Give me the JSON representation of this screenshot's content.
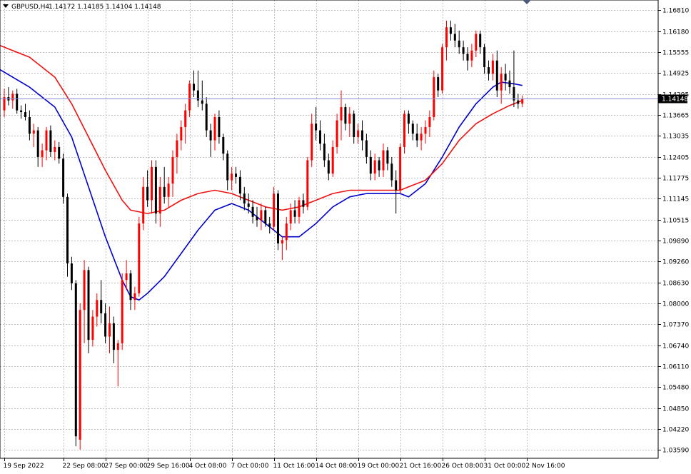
{
  "header": {
    "symbol": "GBPUSD,H4",
    "ohlc": "1.14172 1.14185 1.14104 1.14148"
  },
  "colors": {
    "bull": "#ff0000",
    "bear": "#000000",
    "ma_fast": "#0000cc",
    "ma_slow": "#ee1111",
    "grid": "#c0c0c0",
    "current_bg": "#000000",
    "current_line": "#8c8cd8"
  },
  "chart_data": {
    "type": "candlestick",
    "symbol": "GBPUSD",
    "timeframe": "H4",
    "grid": true,
    "ylim": [
      1.0334,
      1.1712
    ],
    "xlim": [
      0,
      122
    ],
    "y_ticks": [
      "1.16810",
      "1.16180",
      "1.15555",
      "1.14925",
      "1.14295",
      "1.13665",
      "1.13035",
      "1.12405",
      "1.11775",
      "1.11145",
      "1.10515",
      "1.09890",
      "1.09260",
      "1.08630",
      "1.08000",
      "1.07370",
      "1.06740",
      "1.06110",
      "1.05480",
      "1.04850",
      "1.04220",
      "1.03590"
    ],
    "x_ticks": [
      {
        "label": "19 Sep 2022",
        "bar": 0
      },
      {
        "label": "22 Sep 08:00",
        "bar": 14
      },
      {
        "label": "27 Sep 00:00",
        "bar": 24
      },
      {
        "label": "29 Sep 16:00",
        "bar": 34
      },
      {
        "label": "4 Oct 08:00",
        "bar": 44
      },
      {
        "label": "7 Oct 00:00",
        "bar": 54
      },
      {
        "label": "11 Oct 16:00",
        "bar": 64
      },
      {
        "label": "14 Oct 08:00",
        "bar": 74
      },
      {
        "label": "19 Oct 00:00",
        "bar": 84
      },
      {
        "label": "21 Oct 16:00",
        "bar": 94
      },
      {
        "label": "26 Oct 08:00",
        "bar": 104
      },
      {
        "label": "31 Oct 00:00",
        "bar": 114
      },
      {
        "label": "2 Nov 16:00",
        "bar": 124
      }
    ],
    "current_price": "1.14148",
    "candles": [
      {
        "o": 1.138,
        "h": 1.1445,
        "l": 1.136,
        "c": 1.142
      },
      {
        "o": 1.142,
        "h": 1.145,
        "l": 1.1395,
        "c": 1.141
      },
      {
        "o": 1.141,
        "h": 1.144,
        "l": 1.1385,
        "c": 1.143
      },
      {
        "o": 1.143,
        "h": 1.1445,
        "l": 1.137,
        "c": 1.138
      },
      {
        "o": 1.138,
        "h": 1.1395,
        "l": 1.1355,
        "c": 1.1375
      },
      {
        "o": 1.1375,
        "h": 1.14,
        "l": 1.135,
        "c": 1.136
      },
      {
        "o": 1.136,
        "h": 1.138,
        "l": 1.129,
        "c": 1.131
      },
      {
        "o": 1.131,
        "h": 1.134,
        "l": 1.127,
        "c": 1.132
      },
      {
        "o": 1.132,
        "h": 1.133,
        "l": 1.121,
        "c": 1.124
      },
      {
        "o": 1.124,
        "h": 1.128,
        "l": 1.121,
        "c": 1.126
      },
      {
        "o": 1.126,
        "h": 1.133,
        "l": 1.123,
        "c": 1.132
      },
      {
        "o": 1.132,
        "h": 1.1335,
        "l": 1.124,
        "c": 1.1255
      },
      {
        "o": 1.1255,
        "h": 1.129,
        "l": 1.123,
        "c": 1.127
      },
      {
        "o": 1.127,
        "h": 1.1285,
        "l": 1.122,
        "c": 1.1235
      },
      {
        "o": 1.1235,
        "h": 1.125,
        "l": 1.11,
        "c": 1.112
      },
      {
        "o": 1.112,
        "h": 1.113,
        "l": 1.088,
        "c": 1.092
      },
      {
        "o": 1.092,
        "h": 1.094,
        "l": 1.084,
        "c": 1.086
      },
      {
        "o": 1.086,
        "h": 1.087,
        "l": 1.037,
        "c": 1.04
      },
      {
        "o": 1.039,
        "h": 1.08,
        "l": 1.036,
        "c": 1.078
      },
      {
        "o": 1.078,
        "h": 1.093,
        "l": 1.068,
        "c": 1.09
      },
      {
        "o": 1.09,
        "h": 1.091,
        "l": 1.065,
        "c": 1.069
      },
      {
        "o": 1.069,
        "h": 1.078,
        "l": 1.067,
        "c": 1.076
      },
      {
        "o": 1.076,
        "h": 1.083,
        "l": 1.073,
        "c": 1.081
      },
      {
        "o": 1.081,
        "h": 1.087,
        "l": 1.074,
        "c": 1.077
      },
      {
        "o": 1.077,
        "h": 1.08,
        "l": 1.068,
        "c": 1.07
      },
      {
        "o": 1.07,
        "h": 1.079,
        "l": 1.065,
        "c": 1.074
      },
      {
        "o": 1.074,
        "h": 1.076,
        "l": 1.062,
        "c": 1.066
      },
      {
        "o": 1.066,
        "h": 1.069,
        "l": 1.055,
        "c": 1.068
      },
      {
        "o": 1.068,
        "h": 1.089,
        "l": 1.066,
        "c": 1.087
      },
      {
        "o": 1.087,
        "h": 1.093,
        "l": 1.084,
        "c": 1.089
      },
      {
        "o": 1.089,
        "h": 1.09,
        "l": 1.078,
        "c": 1.081
      },
      {
        "o": 1.081,
        "h": 1.085,
        "l": 1.078,
        "c": 1.083
      },
      {
        "o": 1.083,
        "h": 1.106,
        "l": 1.082,
        "c": 1.104
      },
      {
        "o": 1.104,
        "h": 1.118,
        "l": 1.102,
        "c": 1.115
      },
      {
        "o": 1.115,
        "h": 1.12,
        "l": 1.109,
        "c": 1.111
      },
      {
        "o": 1.111,
        "h": 1.123,
        "l": 1.107,
        "c": 1.121
      },
      {
        "o": 1.121,
        "h": 1.123,
        "l": 1.104,
        "c": 1.107
      },
      {
        "o": 1.107,
        "h": 1.118,
        "l": 1.103,
        "c": 1.115
      },
      {
        "o": 1.115,
        "h": 1.121,
        "l": 1.11,
        "c": 1.112
      },
      {
        "o": 1.112,
        "h": 1.118,
        "l": 1.109,
        "c": 1.116
      },
      {
        "o": 1.116,
        "h": 1.126,
        "l": 1.112,
        "c": 1.124
      },
      {
        "o": 1.124,
        "h": 1.131,
        "l": 1.119,
        "c": 1.129
      },
      {
        "o": 1.129,
        "h": 1.135,
        "l": 1.126,
        "c": 1.133
      },
      {
        "o": 1.133,
        "h": 1.14,
        "l": 1.128,
        "c": 1.138
      },
      {
        "o": 1.138,
        "h": 1.147,
        "l": 1.136,
        "c": 1.146
      },
      {
        "o": 1.146,
        "h": 1.15,
        "l": 1.142,
        "c": 1.144
      },
      {
        "o": 1.144,
        "h": 1.15,
        "l": 1.139,
        "c": 1.141
      },
      {
        "o": 1.141,
        "h": 1.147,
        "l": 1.138,
        "c": 1.14
      },
      {
        "o": 1.14,
        "h": 1.142,
        "l": 1.13,
        "c": 1.132
      },
      {
        "o": 1.132,
        "h": 1.134,
        "l": 1.124,
        "c": 1.129
      },
      {
        "o": 1.129,
        "h": 1.137,
        "l": 1.126,
        "c": 1.136
      },
      {
        "o": 1.136,
        "h": 1.138,
        "l": 1.128,
        "c": 1.13
      },
      {
        "o": 1.13,
        "h": 1.131,
        "l": 1.123,
        "c": 1.125
      },
      {
        "o": 1.125,
        "h": 1.126,
        "l": 1.114,
        "c": 1.117
      },
      {
        "o": 1.117,
        "h": 1.121,
        "l": 1.114,
        "c": 1.119
      },
      {
        "o": 1.119,
        "h": 1.121,
        "l": 1.116,
        "c": 1.118
      },
      {
        "o": 1.118,
        "h": 1.12,
        "l": 1.111,
        "c": 1.113
      },
      {
        "o": 1.113,
        "h": 1.115,
        "l": 1.108,
        "c": 1.11
      },
      {
        "o": 1.11,
        "h": 1.113,
        "l": 1.107,
        "c": 1.109
      },
      {
        "o": 1.109,
        "h": 1.111,
        "l": 1.104,
        "c": 1.106
      },
      {
        "o": 1.106,
        "h": 1.109,
        "l": 1.103,
        "c": 1.105
      },
      {
        "o": 1.105,
        "h": 1.11,
        "l": 1.102,
        "c": 1.108
      },
      {
        "o": 1.108,
        "h": 1.109,
        "l": 1.103,
        "c": 1.104
      },
      {
        "o": 1.104,
        "h": 1.106,
        "l": 1.101,
        "c": 1.103
      },
      {
        "o": 1.103,
        "h": 1.115,
        "l": 1.102,
        "c": 1.113
      },
      {
        "o": 1.113,
        "h": 1.114,
        "l": 1.096,
        "c": 1.098
      },
      {
        "o": 1.098,
        "h": 1.1,
        "l": 1.093,
        "c": 1.099
      },
      {
        "o": 1.099,
        "h": 1.106,
        "l": 1.096,
        "c": 1.104
      },
      {
        "o": 1.104,
        "h": 1.11,
        "l": 1.102,
        "c": 1.108
      },
      {
        "o": 1.108,
        "h": 1.111,
        "l": 1.104,
        "c": 1.106
      },
      {
        "o": 1.106,
        "h": 1.112,
        "l": 1.104,
        "c": 1.111
      },
      {
        "o": 1.111,
        "h": 1.113,
        "l": 1.107,
        "c": 1.109
      },
      {
        "o": 1.109,
        "h": 1.124,
        "l": 1.108,
        "c": 1.123
      },
      {
        "o": 1.123,
        "h": 1.137,
        "l": 1.121,
        "c": 1.134
      },
      {
        "o": 1.134,
        "h": 1.139,
        "l": 1.129,
        "c": 1.132
      },
      {
        "o": 1.132,
        "h": 1.135,
        "l": 1.126,
        "c": 1.128
      },
      {
        "o": 1.128,
        "h": 1.131,
        "l": 1.121,
        "c": 1.123
      },
      {
        "o": 1.123,
        "h": 1.125,
        "l": 1.117,
        "c": 1.119
      },
      {
        "o": 1.119,
        "h": 1.129,
        "l": 1.118,
        "c": 1.127
      },
      {
        "o": 1.127,
        "h": 1.137,
        "l": 1.125,
        "c": 1.135
      },
      {
        "o": 1.135,
        "h": 1.144,
        "l": 1.129,
        "c": 1.139
      },
      {
        "o": 1.139,
        "h": 1.14,
        "l": 1.132,
        "c": 1.134
      },
      {
        "o": 1.134,
        "h": 1.139,
        "l": 1.13,
        "c": 1.137
      },
      {
        "o": 1.137,
        "h": 1.138,
        "l": 1.128,
        "c": 1.13
      },
      {
        "o": 1.13,
        "h": 1.134,
        "l": 1.128,
        "c": 1.132
      },
      {
        "o": 1.132,
        "h": 1.135,
        "l": 1.126,
        "c": 1.129
      },
      {
        "o": 1.129,
        "h": 1.131,
        "l": 1.122,
        "c": 1.124
      },
      {
        "o": 1.124,
        "h": 1.126,
        "l": 1.117,
        "c": 1.119
      },
      {
        "o": 1.119,
        "h": 1.125,
        "l": 1.117,
        "c": 1.123
      },
      {
        "o": 1.123,
        "h": 1.124,
        "l": 1.118,
        "c": 1.12
      },
      {
        "o": 1.12,
        "h": 1.128,
        "l": 1.118,
        "c": 1.126
      },
      {
        "o": 1.126,
        "h": 1.127,
        "l": 1.12,
        "c": 1.122
      },
      {
        "o": 1.122,
        "h": 1.124,
        "l": 1.115,
        "c": 1.117
      },
      {
        "o": 1.117,
        "h": 1.12,
        "l": 1.107,
        "c": 1.114
      },
      {
        "o": 1.114,
        "h": 1.128,
        "l": 1.113,
        "c": 1.127
      },
      {
        "o": 1.127,
        "h": 1.138,
        "l": 1.125,
        "c": 1.137
      },
      {
        "o": 1.137,
        "h": 1.138,
        "l": 1.131,
        "c": 1.134
      },
      {
        "o": 1.134,
        "h": 1.135,
        "l": 1.129,
        "c": 1.131
      },
      {
        "o": 1.131,
        "h": 1.134,
        "l": 1.127,
        "c": 1.129
      },
      {
        "o": 1.129,
        "h": 1.133,
        "l": 1.126,
        "c": 1.131
      },
      {
        "o": 1.131,
        "h": 1.135,
        "l": 1.128,
        "c": 1.133
      },
      {
        "o": 1.133,
        "h": 1.138,
        "l": 1.13,
        "c": 1.136
      },
      {
        "o": 1.136,
        "h": 1.15,
        "l": 1.135,
        "c": 1.148
      },
      {
        "o": 1.148,
        "h": 1.149,
        "l": 1.142,
        "c": 1.144
      },
      {
        "o": 1.144,
        "h": 1.158,
        "l": 1.143,
        "c": 1.157
      },
      {
        "o": 1.157,
        "h": 1.165,
        "l": 1.153,
        "c": 1.163
      },
      {
        "o": 1.163,
        "h": 1.165,
        "l": 1.159,
        "c": 1.161
      },
      {
        "o": 1.161,
        "h": 1.164,
        "l": 1.157,
        "c": 1.159
      },
      {
        "o": 1.159,
        "h": 1.162,
        "l": 1.155,
        "c": 1.157
      },
      {
        "o": 1.157,
        "h": 1.159,
        "l": 1.153,
        "c": 1.155
      },
      {
        "o": 1.155,
        "h": 1.157,
        "l": 1.15,
        "c": 1.153
      },
      {
        "o": 1.153,
        "h": 1.158,
        "l": 1.151,
        "c": 1.156
      },
      {
        "o": 1.156,
        "h": 1.162,
        "l": 1.154,
        "c": 1.161
      },
      {
        "o": 1.161,
        "h": 1.162,
        "l": 1.155,
        "c": 1.157
      },
      {
        "o": 1.157,
        "h": 1.158,
        "l": 1.149,
        "c": 1.151
      },
      {
        "o": 1.151,
        "h": 1.153,
        "l": 1.147,
        "c": 1.149
      },
      {
        "o": 1.149,
        "h": 1.155,
        "l": 1.147,
        "c": 1.153
      },
      {
        "o": 1.153,
        "h": 1.156,
        "l": 1.142,
        "c": 1.144
      },
      {
        "o": 1.144,
        "h": 1.151,
        "l": 1.14,
        "c": 1.149
      },
      {
        "o": 1.149,
        "h": 1.152,
        "l": 1.144,
        "c": 1.147
      },
      {
        "o": 1.147,
        "h": 1.15,
        "l": 1.143,
        "c": 1.145
      },
      {
        "o": 1.145,
        "h": 1.156,
        "l": 1.139,
        "c": 1.141
      },
      {
        "o": 1.141,
        "h": 1.143,
        "l": 1.1385,
        "c": 1.14
      },
      {
        "o": 1.14,
        "h": 1.1425,
        "l": 1.139,
        "c": 1.1415
      }
    ],
    "series": [
      {
        "kind": "moving-average",
        "color": "#0000cc",
        "points": [
          [
            -2,
            1.151
          ],
          [
            6,
            1.145
          ],
          [
            12,
            1.139
          ],
          [
            16,
            1.13
          ],
          [
            20,
            1.115
          ],
          [
            24,
            1.1
          ],
          [
            28,
            1.087
          ],
          [
            30,
            1.082
          ],
          [
            32,
            1.081
          ],
          [
            34,
            1.083
          ],
          [
            38,
            1.088
          ],
          [
            42,
            1.095
          ],
          [
            46,
            1.102
          ],
          [
            50,
            1.108
          ],
          [
            54,
            1.11
          ],
          [
            58,
            1.108
          ],
          [
            62,
            1.104
          ],
          [
            66,
            1.1
          ],
          [
            70,
            1.1
          ],
          [
            74,
            1.104
          ],
          [
            78,
            1.109
          ],
          [
            82,
            1.112
          ],
          [
            86,
            1.113
          ],
          [
            90,
            1.113
          ],
          [
            94,
            1.113
          ],
          [
            96,
            1.112
          ],
          [
            100,
            1.116
          ],
          [
            104,
            1.124
          ],
          [
            108,
            1.133
          ],
          [
            112,
            1.14
          ],
          [
            116,
            1.145
          ],
          [
            118,
            1.1465
          ],
          [
            121,
            1.146
          ],
          [
            123,
            1.1455
          ]
        ]
      },
      {
        "kind": "moving-average",
        "color": "#ee1111",
        "points": [
          [
            -2,
            1.158
          ],
          [
            6,
            1.154
          ],
          [
            12,
            1.148
          ],
          [
            16,
            1.14
          ],
          [
            20,
            1.13
          ],
          [
            24,
            1.12
          ],
          [
            28,
            1.111
          ],
          [
            30,
            1.108
          ],
          [
            34,
            1.107
          ],
          [
            38,
            1.108
          ],
          [
            42,
            1.111
          ],
          [
            46,
            1.113
          ],
          [
            50,
            1.114
          ],
          [
            54,
            1.113
          ],
          [
            58,
            1.111
          ],
          [
            62,
            1.109
          ],
          [
            66,
            1.108
          ],
          [
            70,
            1.109
          ],
          [
            74,
            1.111
          ],
          [
            78,
            1.113
          ],
          [
            82,
            1.114
          ],
          [
            86,
            1.114
          ],
          [
            90,
            1.114
          ],
          [
            94,
            1.114
          ],
          [
            96,
            1.115
          ],
          [
            100,
            1.117
          ],
          [
            104,
            1.122
          ],
          [
            108,
            1.129
          ],
          [
            112,
            1.134
          ],
          [
            116,
            1.137
          ],
          [
            120,
            1.1395
          ],
          [
            123,
            1.141
          ]
        ]
      }
    ]
  }
}
